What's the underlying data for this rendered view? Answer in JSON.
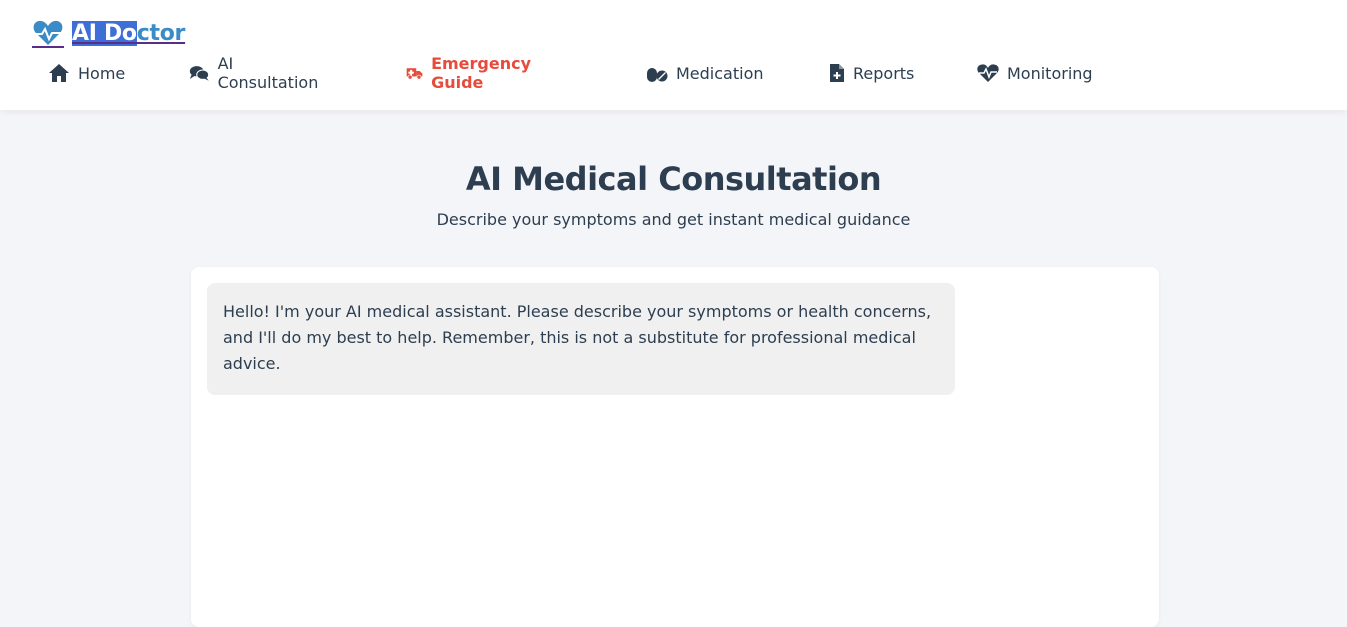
{
  "header": {
    "logo": {
      "text_selected": "AI Do",
      "text_rest": "ctor",
      "icon": "heart-pulse-icon"
    },
    "nav": [
      {
        "label": "Home",
        "icon": "home-icon",
        "active": false
      },
      {
        "label": "AI Consultation",
        "icon": "chat-bubbles-icon",
        "active": false
      },
      {
        "label": "Emergency Guide",
        "icon": "ambulance-icon",
        "active": true
      },
      {
        "label": "Medication",
        "icon": "pills-icon",
        "active": false
      },
      {
        "label": "Reports",
        "icon": "medical-file-icon",
        "active": false
      },
      {
        "label": "Monitoring",
        "icon": "heart-monitor-icon",
        "active": false
      }
    ]
  },
  "main": {
    "title": "AI Medical Consultation",
    "subtitle": "Describe your symptoms and get instant medical guidance",
    "messages": [
      {
        "sender": "assistant",
        "text": "Hello! I'm your AI medical assistant. Please describe your symptoms or health concerns, and I'll do my best to help. Remember, this is not a substitute for professional medical advice."
      }
    ]
  },
  "colors": {
    "primary_text": "#2c3e50",
    "accent_blue": "#3b8bc6",
    "emergency_red": "#e64b3c",
    "page_bg": "#f4f5f8"
  }
}
